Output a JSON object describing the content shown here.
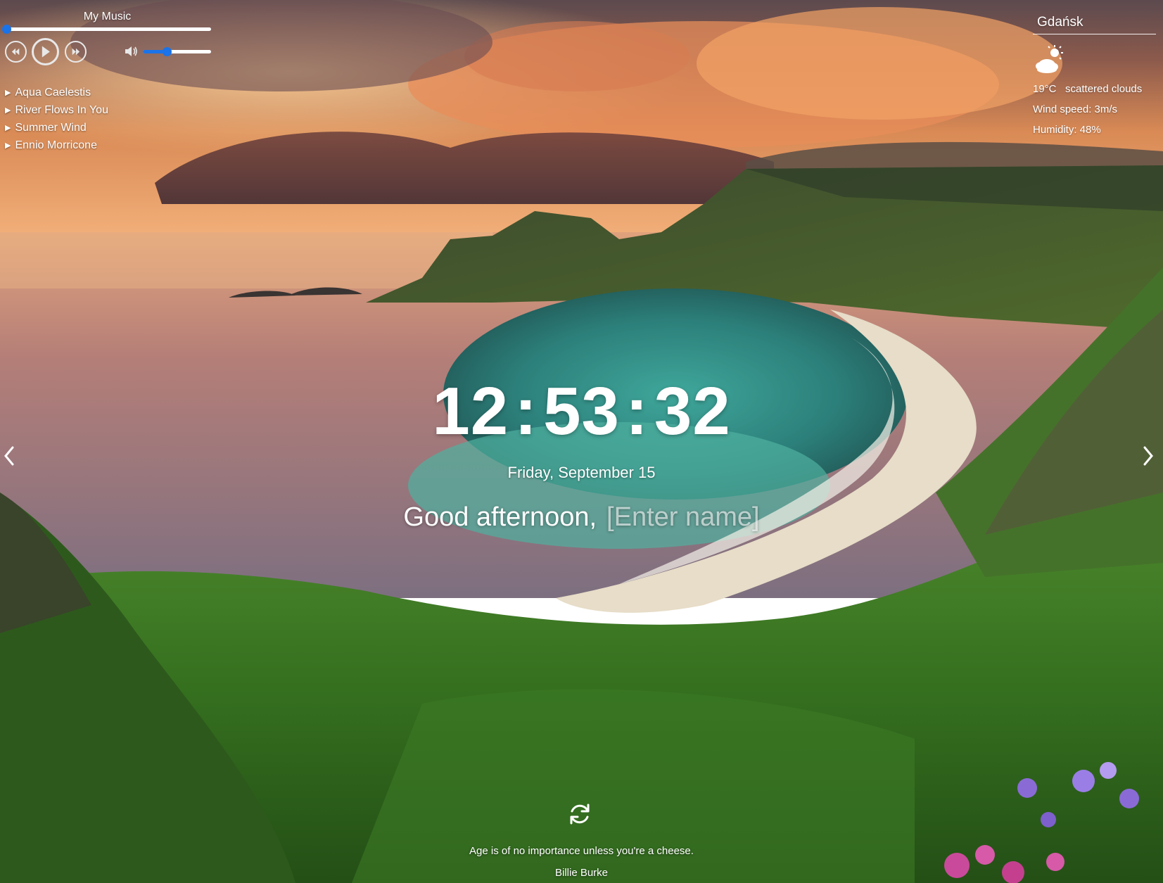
{
  "player": {
    "title": "My Music",
    "progress": 0,
    "volume": 0.35,
    "controls": {
      "previous": "rewind-icon",
      "play": "play-icon",
      "next": "fast-forward-icon",
      "volume": "speaker-icon"
    },
    "playlist": [
      {
        "title": "Aqua Caelestis"
      },
      {
        "title": "River Flows In You"
      },
      {
        "title": "Summer Wind"
      },
      {
        "title": "Ennio Morricone"
      }
    ],
    "accent_color": "#1a73e8"
  },
  "weather": {
    "city": "Gdańsk",
    "icon": "scattered-clouds-icon",
    "temperature": "19°C",
    "description": "scattered clouds",
    "wind": "Wind speed: 3m/s",
    "humidity": "Humidity: 48%"
  },
  "clock": {
    "hours": "12",
    "minutes": "53",
    "seconds": "32",
    "separator": ":"
  },
  "date": "Friday, September 15",
  "greeting": {
    "text": "Good afternoon,",
    "name_placeholder": "[Enter name]"
  },
  "navigation": {
    "prev": "chevron-left-icon",
    "next": "chevron-right-icon"
  },
  "quote": {
    "text": "Age is of no importance unless you're a cheese.",
    "author": "Billie Burke",
    "refresh_icon": "refresh-icon"
  }
}
